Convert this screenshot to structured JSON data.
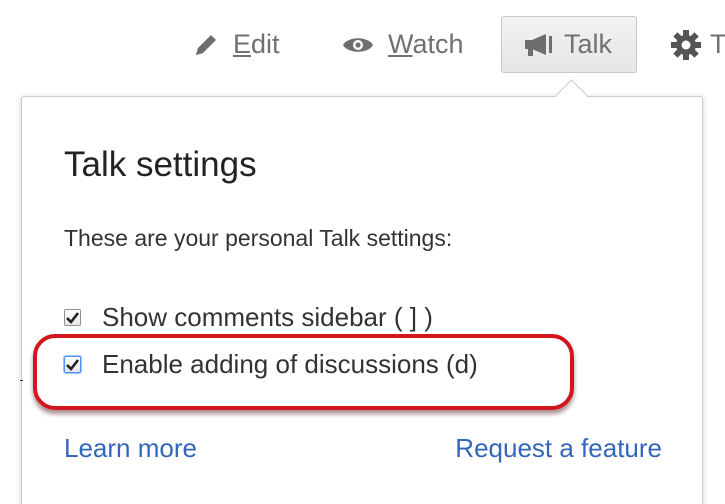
{
  "toolbar": {
    "edit": {
      "mnemonic": "E",
      "rest": "dit",
      "icon": "pencil-icon"
    },
    "watch": {
      "mnemonic": "W",
      "rest": "atch",
      "icon": "eye-icon"
    },
    "talk": {
      "label": "Talk",
      "icon": "megaphone-icon",
      "active": true
    },
    "tools": {
      "label": "T",
      "icon": "gear-icon"
    }
  },
  "popup": {
    "title": "Talk settings",
    "description": "These are your personal Talk settings:",
    "options": [
      {
        "label": "Show comments sidebar ( ] )",
        "checked": true
      },
      {
        "label": "Enable adding of discussions (d)",
        "checked": true,
        "highlighted": true
      }
    ],
    "links": {
      "learn_more": "Learn more",
      "request_feature": "Request a feature"
    }
  },
  "colors": {
    "link": "#3366bb",
    "highlight": "#d2151f",
    "toolbar_text": "#707070"
  }
}
